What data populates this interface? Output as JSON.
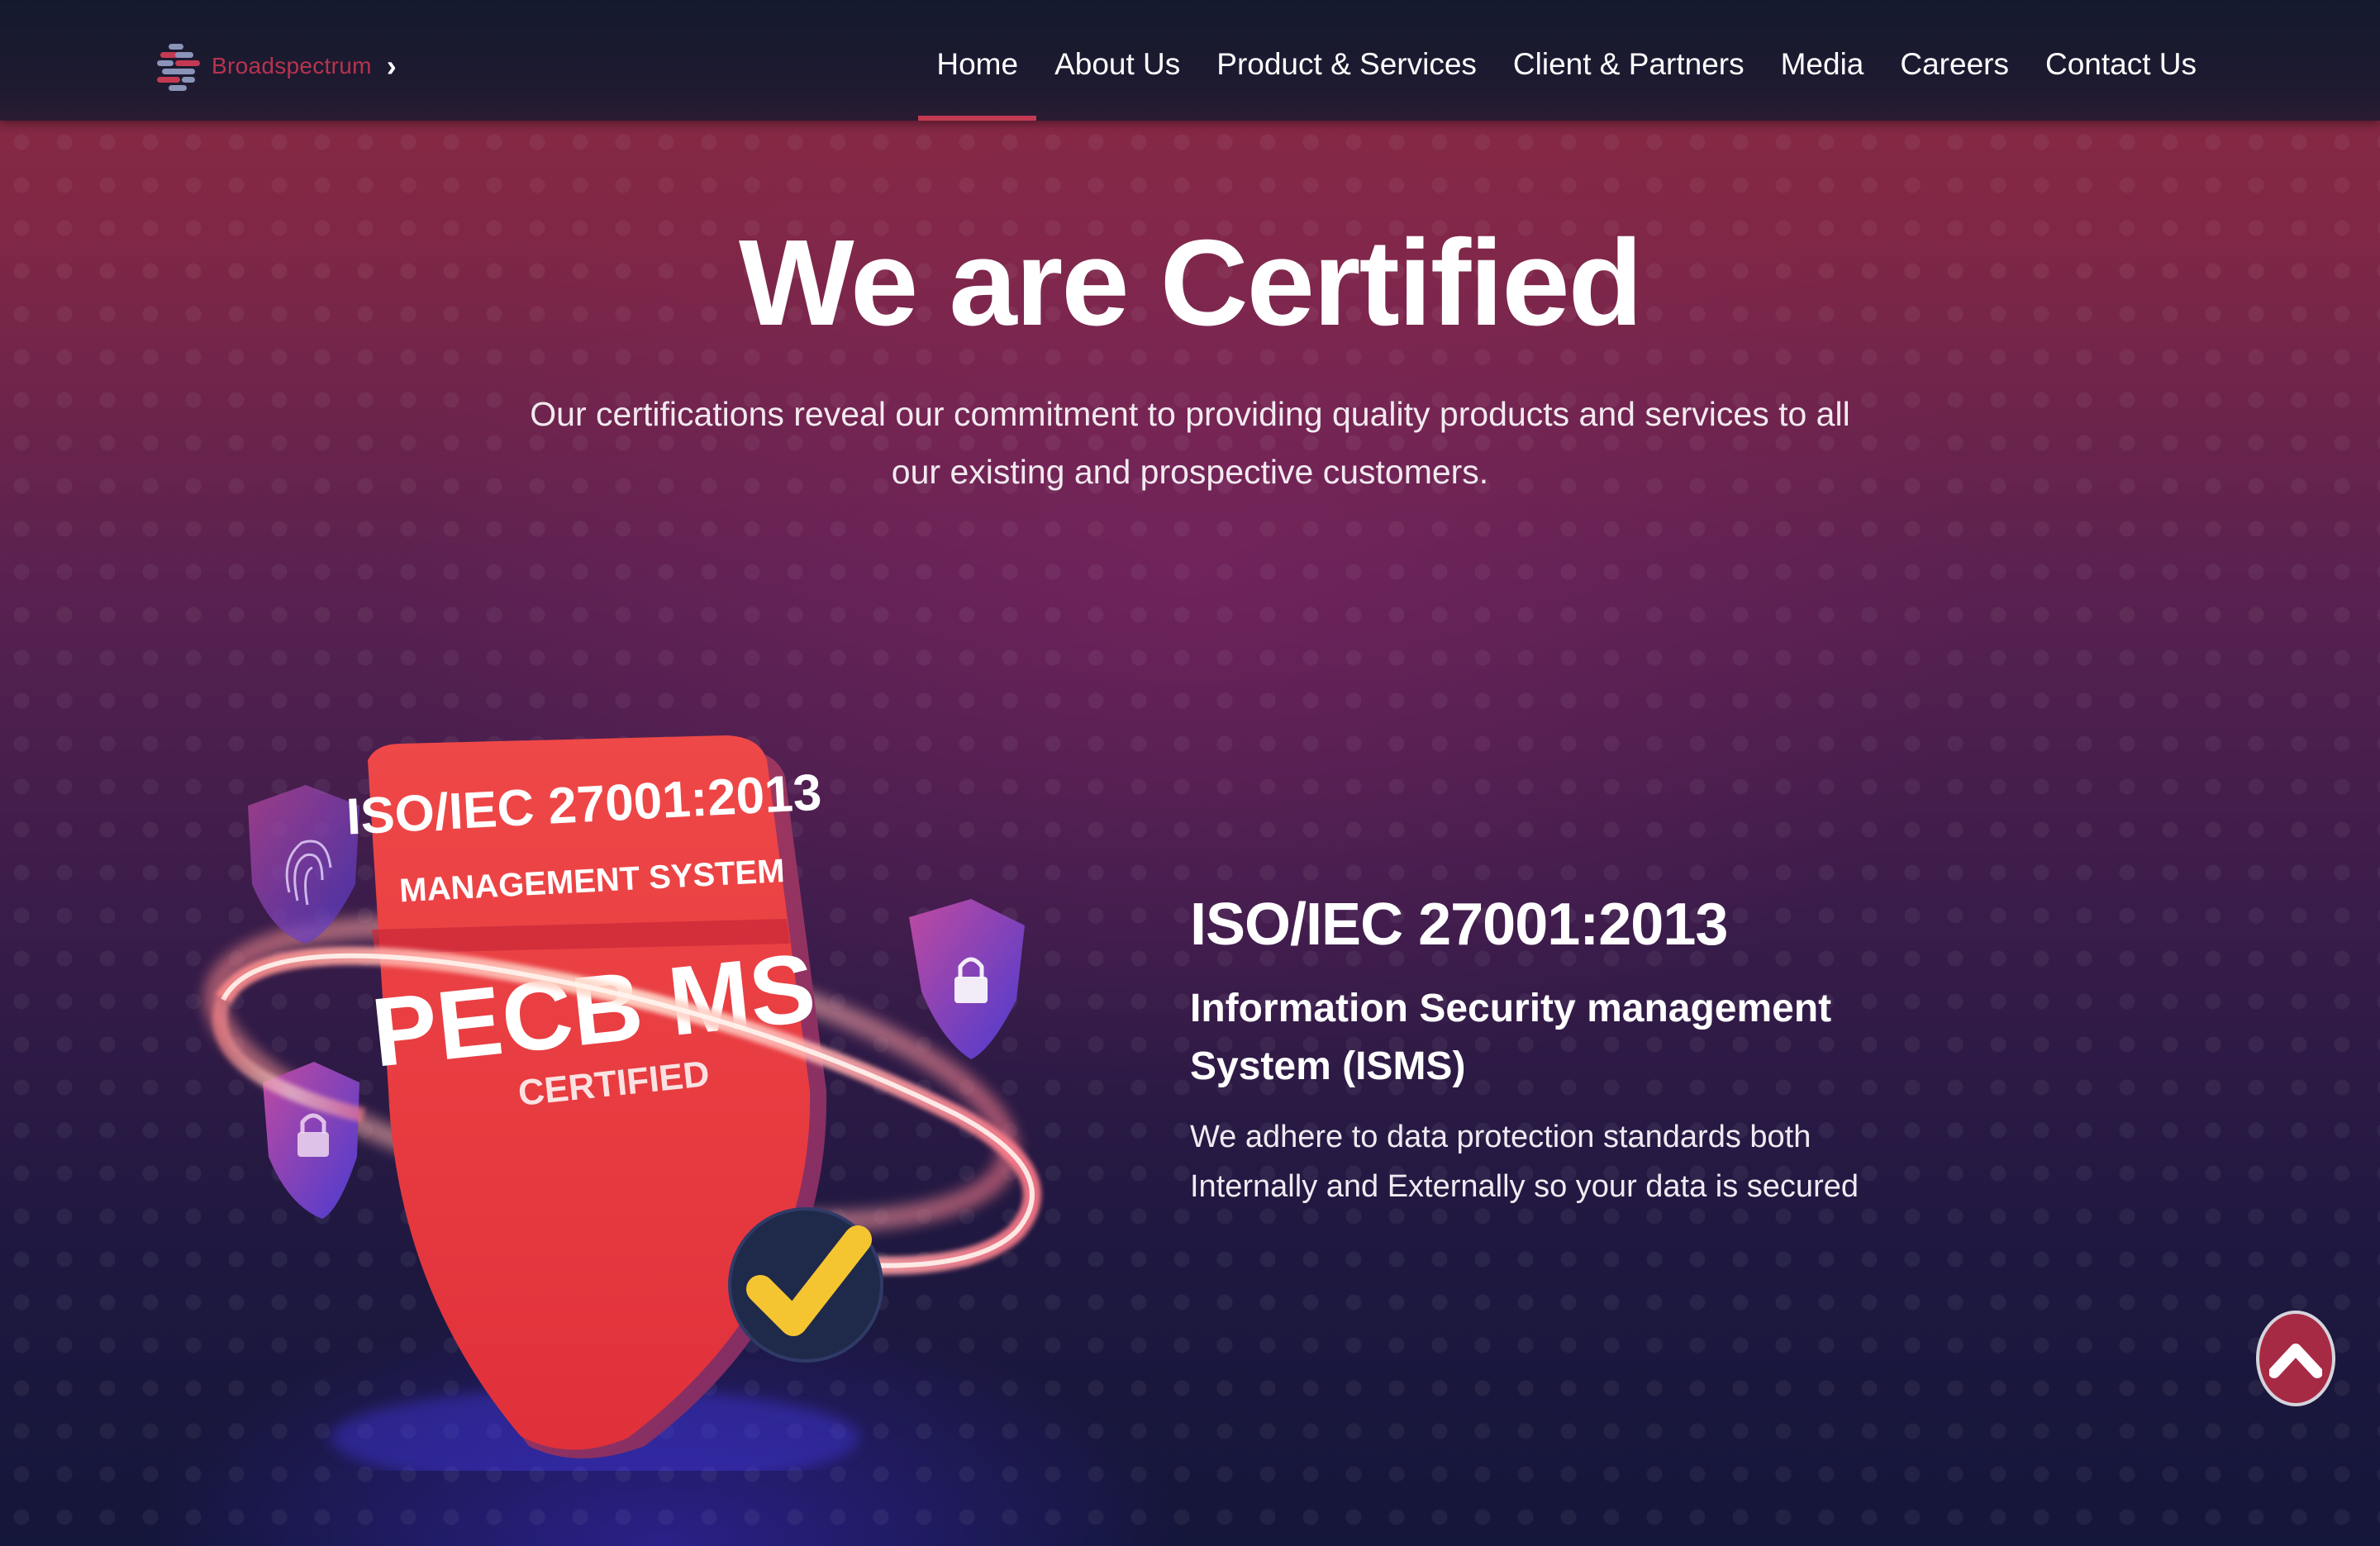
{
  "nav": {
    "brand_name": "Broadspectrum",
    "brand_chevron": "›",
    "items": [
      {
        "label": "Home",
        "active": true
      },
      {
        "label": "About Us",
        "active": false
      },
      {
        "label": "Product & Services",
        "active": false
      },
      {
        "label": "Client & Partners",
        "active": false
      },
      {
        "label": "Media",
        "active": false
      },
      {
        "label": "Careers",
        "active": false
      },
      {
        "label": "Contact Us",
        "active": false
      }
    ]
  },
  "hero": {
    "title": "We are Certified",
    "subtitle": "Our certifications reveal our commitment to providing quality products and services to all our existing and prospective customers."
  },
  "certificate": {
    "badge": {
      "line1": "ISO/IEC 27001:2013",
      "line2": "MANAGEMENT SYSTEM",
      "line3": "PECB MS",
      "line4": "CERTIFIED"
    },
    "title": "ISO/IEC 27001:2013",
    "subtitle": "Information Security management System (ISMS)",
    "description": "We adhere to data protection standards both Internally and Externally so your data is secured"
  },
  "scroll_top": {
    "icon": "chevron-up-icon"
  },
  "colors": {
    "accent": "#c33a52",
    "brand": "#b8334f",
    "badge_red": "#e8383f",
    "check_yellow": "#f5c531"
  }
}
